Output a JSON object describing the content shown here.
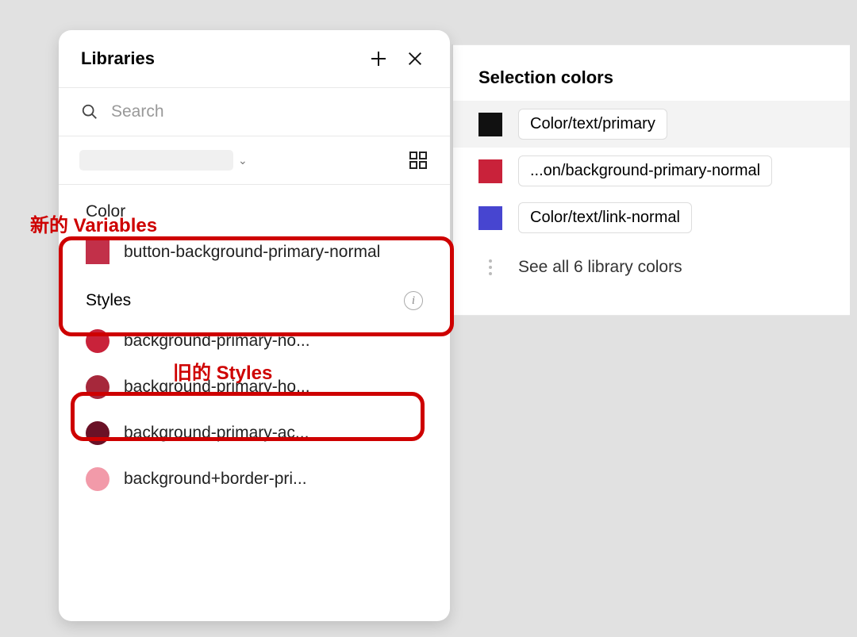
{
  "libraries": {
    "title": "Libraries",
    "search_placeholder": "Search",
    "section_variables_label": "Color",
    "section_styles_label": "Styles",
    "variable_item": {
      "name": "button-background-primary-normal",
      "color": "#c23049"
    },
    "style_items": [
      {
        "name": "background-primary-no...",
        "color": "#c9223a"
      },
      {
        "name": "background-primary-ho...",
        "color": "#a6283b"
      },
      {
        "name": "background-primary-ac...",
        "color": "#6a1126"
      },
      {
        "name": "background+border-pri...",
        "color": "#f29aa9"
      }
    ]
  },
  "annotations": {
    "variables_label": "新的 Variables",
    "styles_label": "旧的 Styles"
  },
  "selection": {
    "title": "Selection colors",
    "items": [
      {
        "label": "Color/text/primary",
        "color": "#111111",
        "selected": true
      },
      {
        "label": "...on/background-primary-normal",
        "color": "#c9223a",
        "selected": false
      },
      {
        "label": "Color/text/link-normal",
        "color": "#4745d0",
        "selected": false
      }
    ],
    "footer": "See all 6 library colors"
  }
}
